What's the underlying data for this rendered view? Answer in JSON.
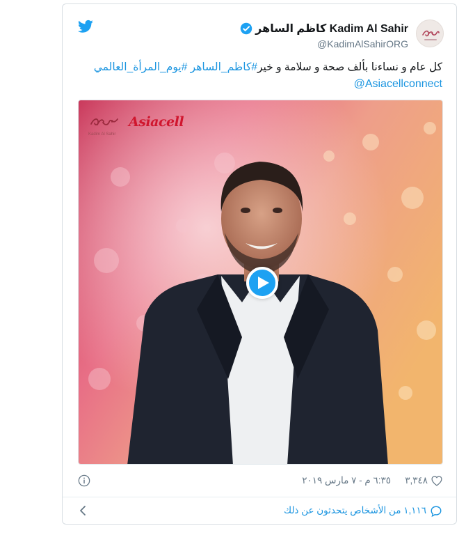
{
  "tweet": {
    "display_name": "كاظم الساهر Kadim Al Sahir",
    "handle": "@KadimAlSahirORG",
    "text_plain": "كل عام و نساءنا بألف صحة و سلامة و خير",
    "hashtags": [
      "#كاظم_الساهر",
      "#يوم_المرأة_العالمي"
    ],
    "mention": "@Asiacellconnect",
    "like_count": "٣,٣٤٨",
    "timestamp": "٦:٣٥ م - ٧ مارس ٢٠١٩",
    "conversation_text": "١,١١٦ من الأشخاص يتحدثون عن ذلك"
  },
  "media": {
    "brand_logo": "Asiacell",
    "signature_caption": "Kadim Al Sahir"
  },
  "icons": {
    "twitter": "twitter-bird-icon",
    "verified": "verified-badge-icon",
    "play": "play-icon",
    "info": "info-icon",
    "like": "heart-icon",
    "conversation": "speech-bubble-icon",
    "back": "chevron-left-icon"
  },
  "colors": {
    "twitter_blue": "#1da1f2",
    "link_blue": "#1b95e0",
    "muted": "#657786"
  }
}
